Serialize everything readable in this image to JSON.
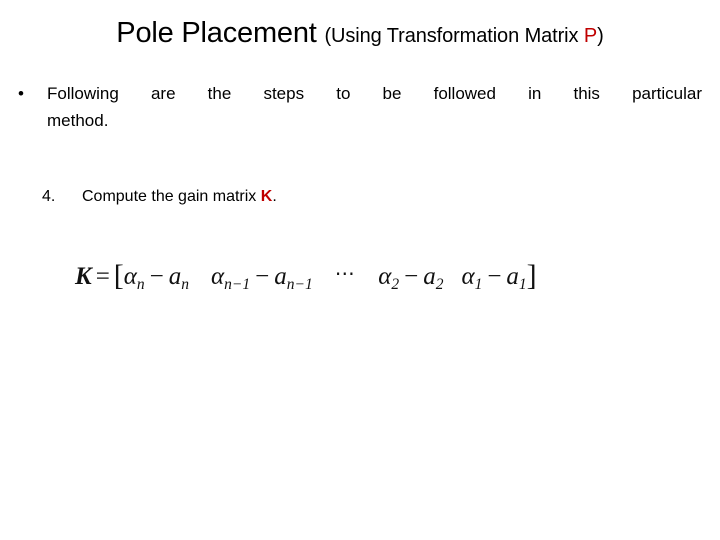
{
  "slide": {
    "background_color": "#FFFFFF",
    "accent_color": "#C00000",
    "text_color": "#000000"
  },
  "title": {
    "main": "Pole Placement ",
    "sub_prefix": "(Using Transformation Matrix ",
    "sub_accent": "P",
    "sub_suffix": ")"
  },
  "bullet": {
    "marker": "•",
    "line1": "Following are the steps to be followed in this particular",
    "line2": "method.",
    "full_text": "Following are the steps to be followed in this particular method."
  },
  "step": {
    "number": "4.",
    "text_before": "Compute the gain matrix ",
    "accent_symbol": "K",
    "text_after": "."
  },
  "equation": {
    "latex": "K = [α_n - a_n   α_{n-1} - a_{n-1}  ⋯  α_2 - a_2   α_1 - a_1]",
    "lhs": "K",
    "equals": "=",
    "open_bracket": "[",
    "close_bracket": "]",
    "ellipsis": "⋯",
    "terms": [
      {
        "alpha": "α",
        "alpha_sub": "n",
        "minus": "−",
        "a": "a",
        "a_sub": "n"
      },
      {
        "alpha": "α",
        "alpha_sub": "n−1",
        "minus": "−",
        "a": "a",
        "a_sub": "n−1"
      },
      {
        "alpha": "α",
        "alpha_sub": "2",
        "minus": "−",
        "a": "a",
        "a_sub": "2"
      },
      {
        "alpha": "α",
        "alpha_sub": "1",
        "minus": "−",
        "a": "a",
        "a_sub": "1"
      }
    ]
  }
}
